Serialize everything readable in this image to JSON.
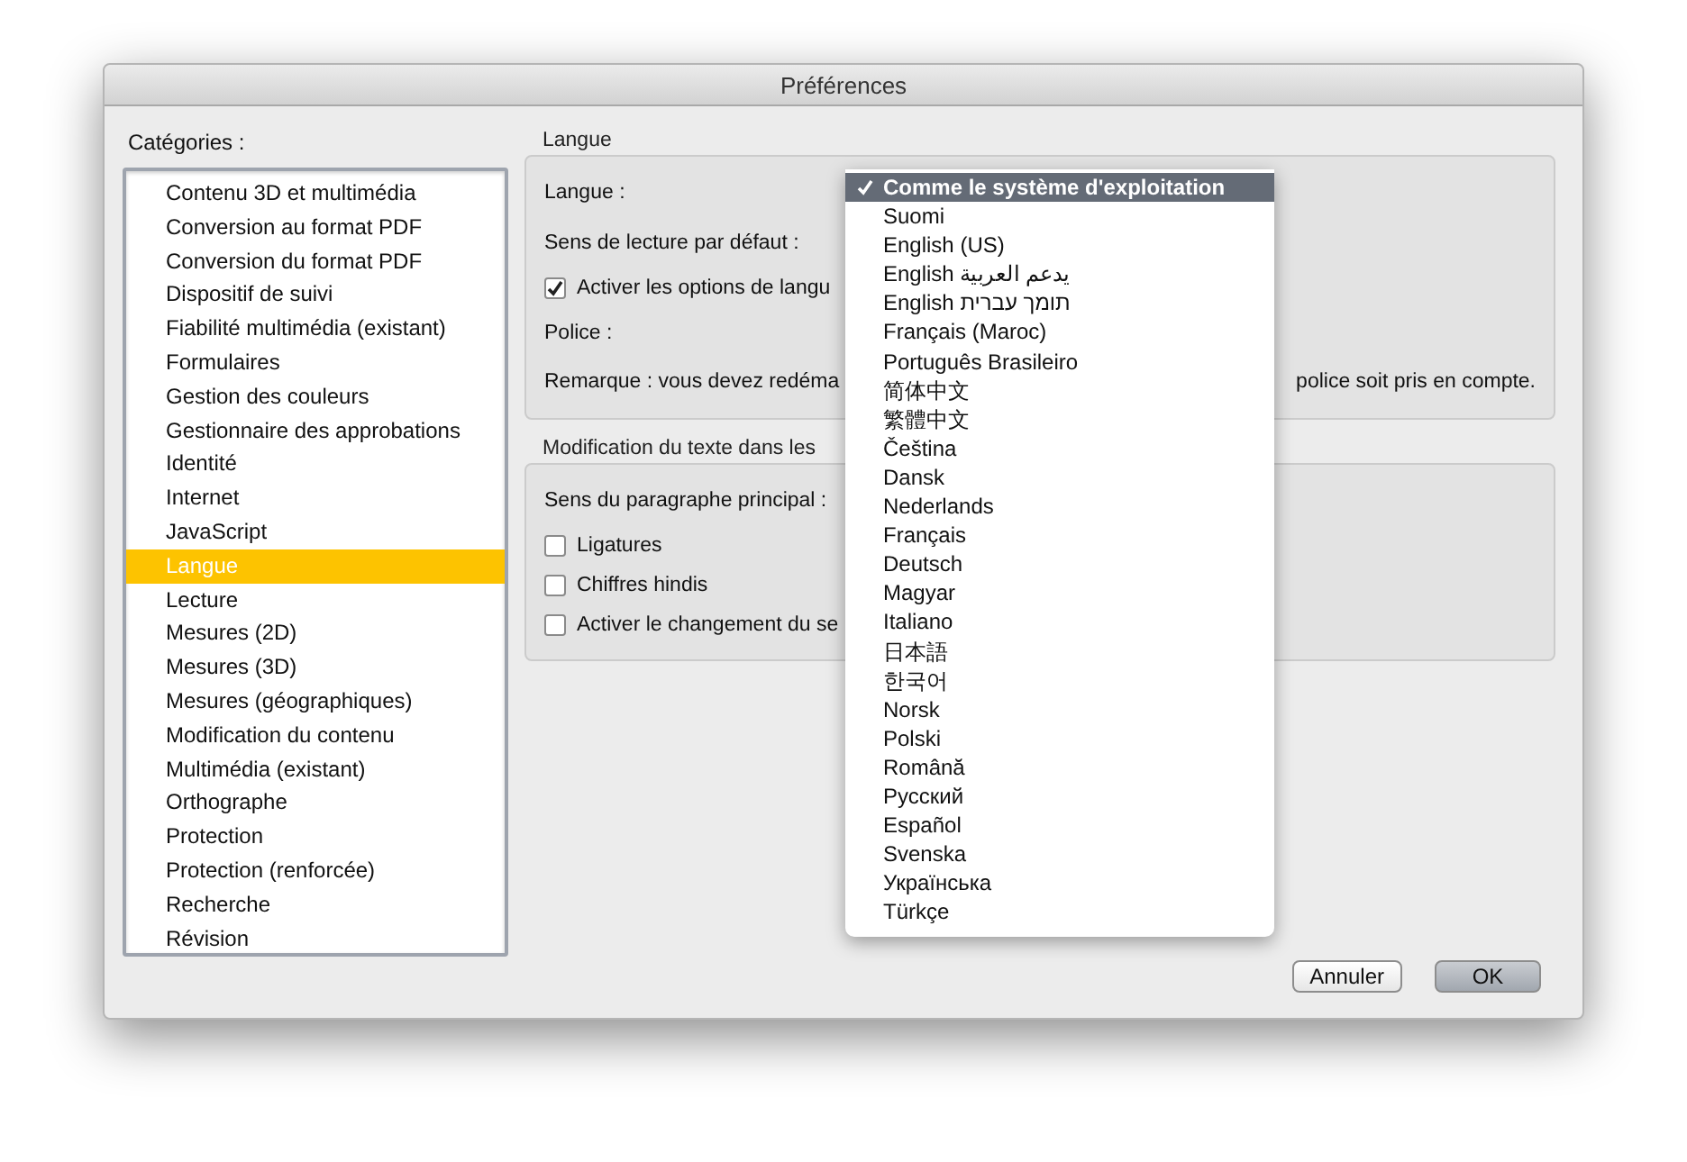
{
  "window": {
    "title": "Préférences"
  },
  "categories": {
    "label": "Catégories :",
    "items": [
      {
        "label": "Contenu 3D et multimédia",
        "selected": false
      },
      {
        "label": "Conversion au format PDF",
        "selected": false
      },
      {
        "label": "Conversion du format PDF",
        "selected": false
      },
      {
        "label": "Dispositif de suivi",
        "selected": false
      },
      {
        "label": "Fiabilité multimédia (existant)",
        "selected": false
      },
      {
        "label": "Formulaires",
        "selected": false
      },
      {
        "label": "Gestion des couleurs",
        "selected": false
      },
      {
        "label": "Gestionnaire des approbations",
        "selected": false
      },
      {
        "label": "Identité",
        "selected": false
      },
      {
        "label": "Internet",
        "selected": false
      },
      {
        "label": "JavaScript",
        "selected": false
      },
      {
        "label": "Langue",
        "selected": true
      },
      {
        "label": "Lecture",
        "selected": false
      },
      {
        "label": "Mesures (2D)",
        "selected": false
      },
      {
        "label": "Mesures (3D)",
        "selected": false
      },
      {
        "label": "Mesures (géographiques)",
        "selected": false
      },
      {
        "label": "Modification du contenu",
        "selected": false
      },
      {
        "label": "Multimédia (existant)",
        "selected": false
      },
      {
        "label": "Orthographe",
        "selected": false
      },
      {
        "label": "Protection",
        "selected": false
      },
      {
        "label": "Protection (renforcée)",
        "selected": false
      },
      {
        "label": "Recherche",
        "selected": false
      },
      {
        "label": "Révision",
        "selected": false
      }
    ]
  },
  "language_section": {
    "title": "Langue",
    "rows": [
      {
        "kind": "select",
        "label": "Langue :"
      },
      {
        "kind": "select",
        "label": "Sens de lecture par défaut :"
      },
      {
        "kind": "checkbox",
        "label": "Activer les options de langu",
        "checked": true
      },
      {
        "kind": "select",
        "label": "Police :"
      },
      {
        "kind": "note",
        "parts": [
          "Remarque : vous devez redéma",
          "police soit pris en compte."
        ]
      }
    ]
  },
  "middle_east_section": {
    "title": "Modification du texte dans les",
    "rows": [
      {
        "kind": "select",
        "label": "Sens du paragraphe principal :"
      },
      {
        "kind": "checkbox",
        "label": "Ligatures",
        "checked": false
      },
      {
        "kind": "checkbox",
        "label": "Chiffres hindis",
        "checked": false
      },
      {
        "kind": "checkbox",
        "label": "Activer le changement du se",
        "checked": false
      }
    ]
  },
  "language_menu": {
    "items": [
      {
        "label": "Comme le système d'exploitation",
        "selected": true
      },
      {
        "label": "Suomi",
        "selected": false
      },
      {
        "label": "English (US)",
        "selected": false
      },
      {
        "label": "English يدعم العربية",
        "selected": false
      },
      {
        "label": "English תומך עברית",
        "selected": false
      },
      {
        "label": "Français (Maroc)",
        "selected": false
      },
      {
        "label": "Português Brasileiro",
        "selected": false
      },
      {
        "label": "简体中文",
        "selected": false
      },
      {
        "label": "繁體中文",
        "selected": false
      },
      {
        "label": "Čeština",
        "selected": false
      },
      {
        "label": "Dansk",
        "selected": false
      },
      {
        "label": "Nederlands",
        "selected": false
      },
      {
        "label": "Français",
        "selected": false
      },
      {
        "label": "Deutsch",
        "selected": false
      },
      {
        "label": "Magyar",
        "selected": false
      },
      {
        "label": "Italiano",
        "selected": false
      },
      {
        "label": "日本語",
        "selected": false
      },
      {
        "label": "한국어",
        "selected": false
      },
      {
        "label": "Norsk",
        "selected": false
      },
      {
        "label": "Polski",
        "selected": false
      },
      {
        "label": "Română",
        "selected": false
      },
      {
        "label": "Русский",
        "selected": false
      },
      {
        "label": "Español",
        "selected": false
      },
      {
        "label": "Svenska",
        "selected": false
      },
      {
        "label": "Українська",
        "selected": false
      },
      {
        "label": "Türkçe",
        "selected": false
      }
    ]
  },
  "buttons": [
    {
      "label": "Annuler",
      "default": false
    },
    {
      "label": "OK",
      "default": true
    }
  ]
}
